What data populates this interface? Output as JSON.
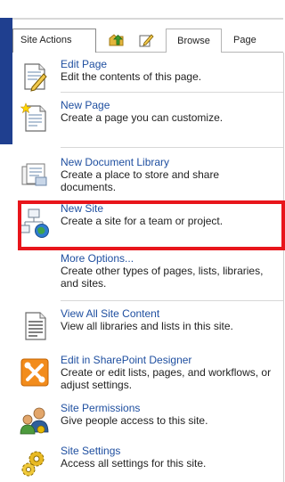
{
  "ribbon": {
    "site_actions_label": "Site Actions",
    "tab_browse": "Browse",
    "tab_page": "Page"
  },
  "menu": {
    "items": [
      {
        "title": "Edit Page",
        "desc": "Edit the contents of this page.",
        "icon": "edit-page-icon"
      },
      {
        "title": "New Page",
        "desc": "Create a page you can customize.",
        "icon": "new-page-icon"
      },
      {
        "title": "New Document Library",
        "desc": "Create a place to store and share documents.",
        "icon": "document-library-icon"
      },
      {
        "title": "New Site",
        "desc": "Create a site for a team or project.",
        "icon": "new-site-icon"
      },
      {
        "title": "More Options...",
        "desc": "Create other types of pages, lists, libraries, and sites.",
        "icon": ""
      },
      {
        "title": "View All Site Content",
        "desc": "View all libraries and lists in this site.",
        "icon": "site-content-icon"
      },
      {
        "title": "Edit in SharePoint Designer",
        "desc": "Create or edit lists, pages, and workflows, or adjust settings.",
        "icon": "sharepoint-designer-icon"
      },
      {
        "title": "Site Permissions",
        "desc": "Give people access to this site.",
        "icon": "permissions-icon"
      },
      {
        "title": "Site Settings",
        "desc": "Access all settings for this site.",
        "icon": "settings-gears-icon"
      }
    ]
  },
  "colors": {
    "link": "#1f4fa0",
    "highlight": "#e8151b",
    "accent_bar": "#1f3f8f"
  }
}
